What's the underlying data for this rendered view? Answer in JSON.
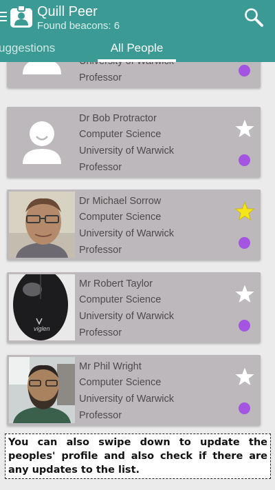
{
  "app": {
    "title": "Quill Peer",
    "subtitle": "Found beacons: 6",
    "icons": {
      "menu": "menu-icon",
      "app": "badge-person-icon",
      "search": "search-icon"
    },
    "colors": {
      "primary": "#3b9a94",
      "card": "#bdb8bb",
      "status_dot": "#a354e0",
      "star_active": "#f5e61a",
      "star_inactive": "#ffffff"
    }
  },
  "tabs": [
    {
      "label": "uggestions",
      "selected": false
    },
    {
      "label": "All People",
      "selected": true
    }
  ],
  "people": [
    {
      "name": "",
      "department": "",
      "university": "University of Warwick",
      "role": "Professor",
      "photo": "default-avatar",
      "starred": false
    },
    {
      "name": "Dr Bob Protractor",
      "department": "Computer Science",
      "university": "University of Warwick",
      "role": "Professor",
      "photo": "default-avatar",
      "starred": false
    },
    {
      "name": "Dr Michael Sorrow",
      "department": "Computer Science",
      "university": "University of Warwick",
      "role": "Professor",
      "photo": "photo-man-glasses",
      "starred": true
    },
    {
      "name": "Mr Robert Taylor",
      "department": "Computer Science",
      "university": "University of Warwick",
      "role": "Professor",
      "photo": "photo-computer-mouse",
      "starred": false
    },
    {
      "name": "Mr Phil Wright",
      "department": "Computer Science",
      "university": "University of Warwick",
      "role": "Professor",
      "photo": "photo-man-beard",
      "starred": false
    }
  ],
  "tip": {
    "text": "You can also swipe down to update the peoples' profile and also check if there are any updates to the list."
  }
}
